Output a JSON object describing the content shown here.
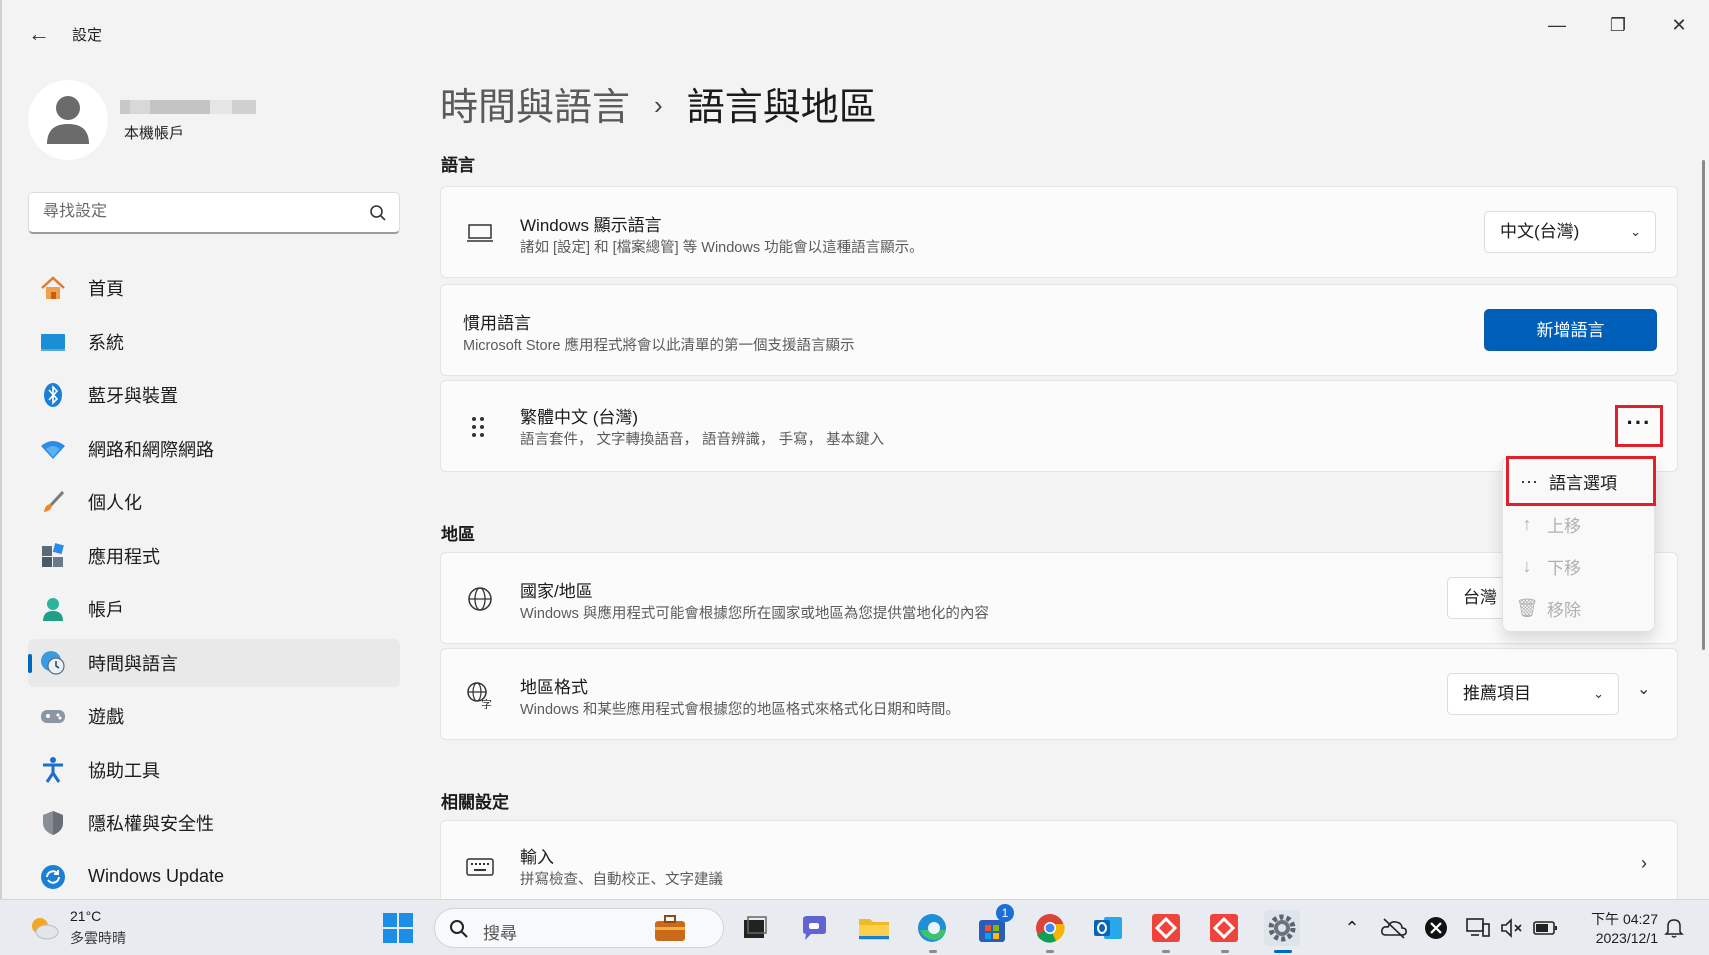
{
  "window": {
    "app_title": "設定",
    "controls": {
      "minimize": "—",
      "maximize": "❐",
      "close": "✕"
    }
  },
  "user": {
    "account_type": "本機帳戶"
  },
  "search": {
    "placeholder": "尋找設定"
  },
  "sidebar": {
    "items": [
      {
        "label": "首頁",
        "icon": "home-icon"
      },
      {
        "label": "系統",
        "icon": "monitor-icon"
      },
      {
        "label": "藍牙與裝置",
        "icon": "bluetooth-icon"
      },
      {
        "label": "網路和網際網路",
        "icon": "wifi-icon"
      },
      {
        "label": "個人化",
        "icon": "paintbrush-icon"
      },
      {
        "label": "應用程式",
        "icon": "apps-icon"
      },
      {
        "label": "帳戶",
        "icon": "person-icon"
      },
      {
        "label": "時間與語言",
        "icon": "clock-globe-icon",
        "active": true
      },
      {
        "label": "遊戲",
        "icon": "gamepad-icon"
      },
      {
        "label": "協助工具",
        "icon": "accessibility-icon"
      },
      {
        "label": "隱私權與安全性",
        "icon": "shield-icon"
      },
      {
        "label": "Windows Update",
        "icon": "update-icon"
      }
    ]
  },
  "breadcrumb": {
    "parent": "時間與語言",
    "separator": "›",
    "current": "語言與地區"
  },
  "language_section": {
    "header": "語言",
    "display_language": {
      "title": "Windows 顯示語言",
      "desc": "諸如 [設定] 和 [檔案總管] 等 Windows 功能會以這種語言顯示。",
      "value": "中文(台灣)"
    },
    "preferred": {
      "title": "慣用語言",
      "desc": "Microsoft Store 應用程式將會以此清單的第一個支援語言顯示",
      "button": "新增語言"
    },
    "installed": {
      "title": "繁體中文 (台灣)",
      "desc": "語言套件， 文字轉換語音， 語音辨識， 手寫， 基本鍵入",
      "more": "···"
    }
  },
  "context_menu": {
    "items": [
      {
        "label": "語言選項",
        "icon": "more-icon",
        "glyph": "···",
        "enabled": true
      },
      {
        "label": "上移",
        "icon": "arrow-up-icon",
        "glyph": "↑",
        "enabled": false
      },
      {
        "label": "下移",
        "icon": "arrow-down-icon",
        "glyph": "↓",
        "enabled": false
      },
      {
        "label": "移除",
        "icon": "trash-icon",
        "glyph": "🗑",
        "enabled": false
      }
    ]
  },
  "region_section": {
    "header": "地區",
    "country": {
      "title": "國家/地區",
      "desc": "Windows 與應用程式可能會根據您所在國家或地區為您提供當地化的內容",
      "value": "台灣"
    },
    "format": {
      "title": "地區格式",
      "desc": "Windows 和某些應用程式會根據您的地區格式來格式化日期和時間。",
      "value": "推薦項目"
    }
  },
  "related_section": {
    "header": "相關設定",
    "input": {
      "title": "輸入",
      "desc": "拼寫檢查、自動校正、文字建議"
    }
  },
  "taskbar": {
    "weather_temp": "21°C",
    "weather_desc": "多雲時晴",
    "search_label": "搜尋",
    "store_badge": "1",
    "time": "下午 04:27",
    "date": "2023/12/1"
  },
  "colors": {
    "accent": "#005fb8",
    "highlight_box": "#e0202b"
  }
}
